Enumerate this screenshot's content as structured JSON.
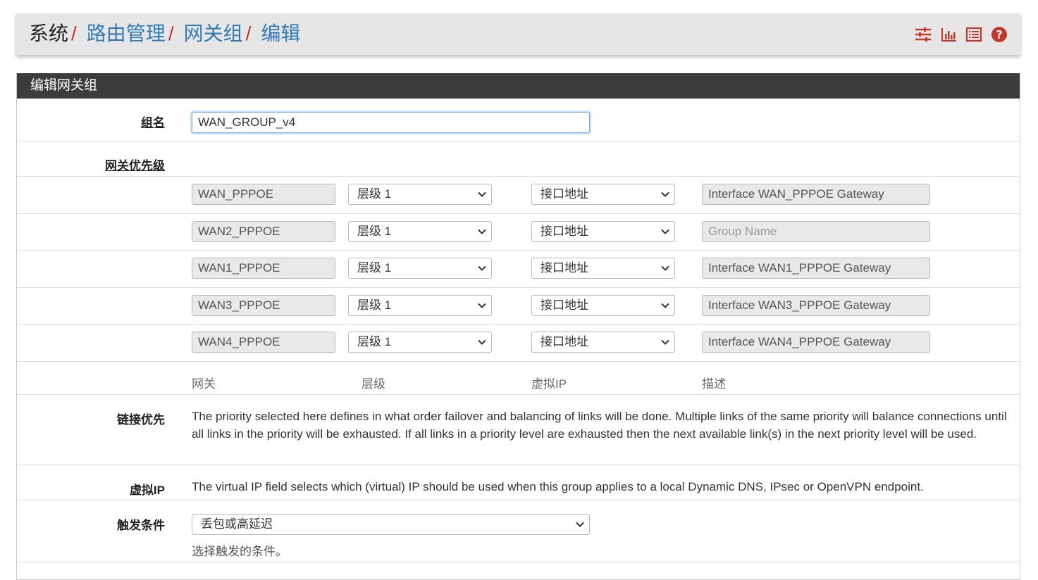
{
  "breadcrumb": {
    "root": "系统",
    "links": [
      "路由管理",
      "网关组",
      "编辑"
    ],
    "separator": "/"
  },
  "toolbar": {
    "icons": [
      "sliders-icon",
      "bar-chart-icon",
      "list-icon",
      "help-circle-icon"
    ],
    "accent": "#c0392b"
  },
  "panel": {
    "title": "编辑网关组"
  },
  "group_name": {
    "label": "组名",
    "value": "WAN_GROUP_v4"
  },
  "priority": {
    "label": "网关优先级",
    "rows": [
      {
        "gateway": "WAN_PPPOE",
        "tier": "层级 1",
        "vip": "接口地址",
        "description": "Interface WAN_PPPOE Gateway",
        "description_placeholder": ""
      },
      {
        "gateway": "WAN2_PPPOE",
        "tier": "层级 1",
        "vip": "接口地址",
        "description": "",
        "description_placeholder": "Group Name"
      },
      {
        "gateway": "WAN1_PPPOE",
        "tier": "层级 1",
        "vip": "接口地址",
        "description": "Interface WAN1_PPPOE Gateway",
        "description_placeholder": ""
      },
      {
        "gateway": "WAN3_PPPOE",
        "tier": "层级 1",
        "vip": "接口地址",
        "description": "Interface WAN3_PPPOE Gateway",
        "description_placeholder": ""
      },
      {
        "gateway": "WAN4_PPPOE",
        "tier": "层级 1",
        "vip": "接口地址",
        "description": "Interface WAN4_PPPOE Gateway",
        "description_placeholder": ""
      }
    ],
    "columns": [
      "网关",
      "层级",
      "虚拟IP",
      "描述"
    ]
  },
  "link_priority": {
    "label": "链接优先",
    "text": "The priority selected here defines in what order failover and balancing of links will be done. Multiple links of the same priority will balance connections until all links in the priority will be exhausted. If all links in a priority level are exhausted then the next available link(s) in the next priority level will be used."
  },
  "virtual_ip": {
    "label": "虚拟IP",
    "text": "The virtual IP field selects which (virtual) IP should be used when this group applies to a local Dynamic DNS, IPsec or OpenVPN endpoint."
  },
  "trigger": {
    "label": "触发条件",
    "selected": "丢包或高延迟",
    "hint": "选择触发的条件。"
  }
}
